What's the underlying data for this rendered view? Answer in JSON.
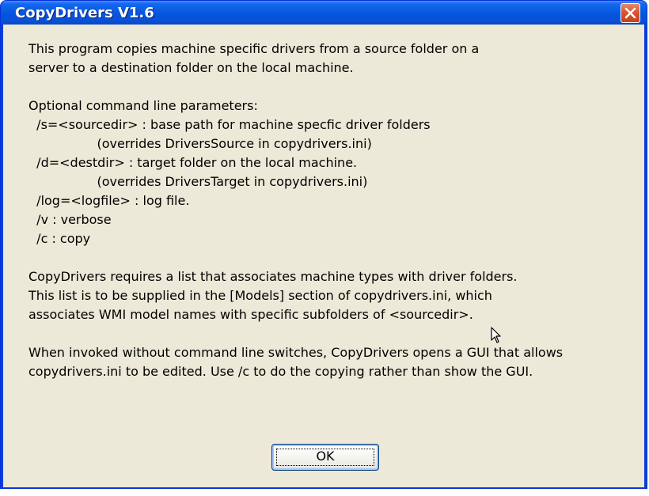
{
  "window": {
    "title": "CopyDrivers V1.6",
    "close_label": "Close"
  },
  "message": {
    "lines": [
      "This program copies machine specific drivers from a source folder on a",
      "server to a destination folder on the local machine.",
      "",
      "Optional command line parameters:",
      "  /s=<sourcedir> : base path for machine specfic driver folders",
      "                 (overrides DriversSource in copydrivers.ini)",
      "  /d=<destdir> : target folder on the local machine.",
      "                 (overrides DriversTarget in copydrivers.ini)",
      "  /log=<logfile> : log file.",
      "  /v : verbose",
      "  /c : copy",
      "",
      "CopyDrivers requires a list that associates machine types with driver folders.",
      "This list is to be supplied in the [Models] section of copydrivers.ini, which",
      "associates WMI model names with specific subfolders of <sourcedir>.",
      "",
      "When invoked without command line switches, CopyDrivers opens a GUI that allows",
      "copydrivers.ini to be edited. Use /c to do the copying rather than show the GUI."
    ]
  },
  "buttons": {
    "ok_label": "OK"
  },
  "colors": {
    "titlebar": "#0a5ce3",
    "client_background": "#ece9d8",
    "close_button": "#d9542f"
  },
  "icons": {
    "close": "close-x-icon",
    "pointer": "mouse-pointer-icon"
  }
}
